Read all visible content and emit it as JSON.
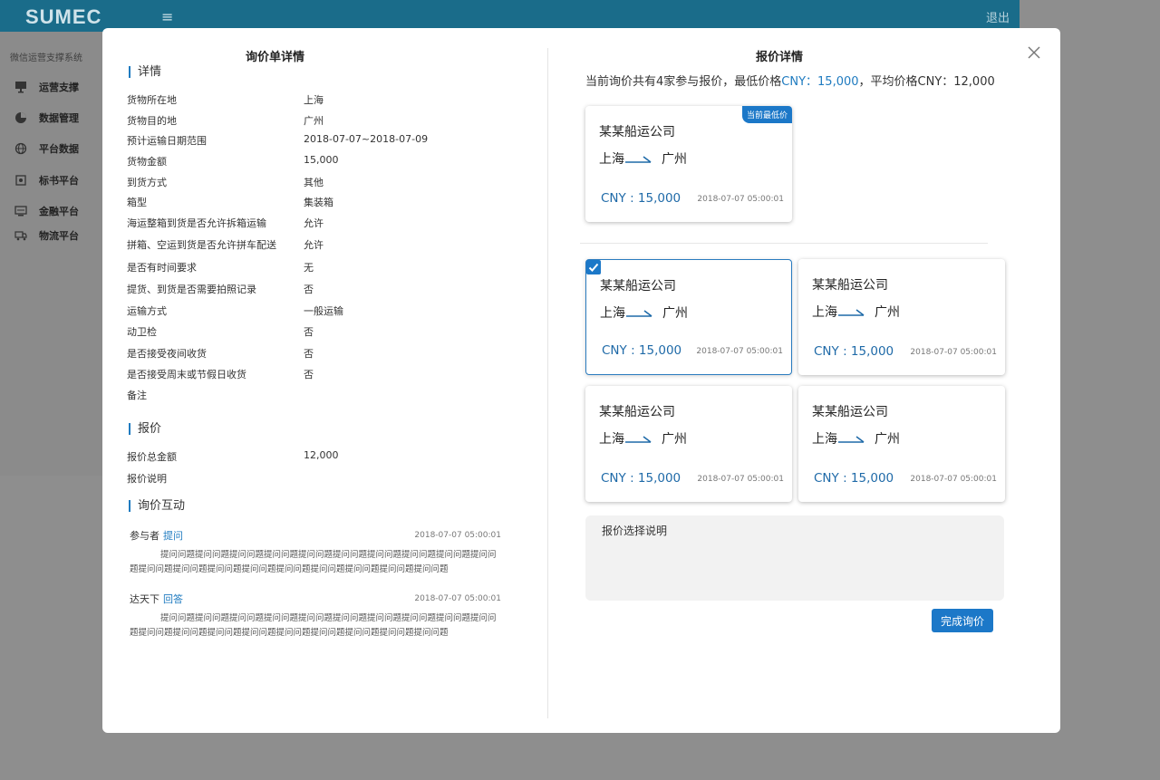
{
  "app": {
    "logo": "SUMEC",
    "menu_icon": "≡",
    "logout": "退出",
    "system_title": "微信运营支撑系统",
    "nav": [
      {
        "label": "运营支撑",
        "icon": "monitor-icon"
      },
      {
        "label": "数据管理",
        "icon": "pie-chart-icon"
      },
      {
        "label": "平台数据",
        "icon": "globe-icon"
      },
      {
        "label": "标书平台",
        "icon": "bid-icon"
      },
      {
        "label": "金融平台",
        "icon": "finance-icon"
      },
      {
        "label": "物流平台",
        "icon": "truck-icon"
      }
    ]
  },
  "left_panel": {
    "title": "询价单详情",
    "details_title": "详情",
    "details": [
      {
        "k": "货物所在地",
        "v": "上海"
      },
      {
        "k": "货物目的地",
        "v": "广州"
      },
      {
        "k": "预计运输日期范围",
        "v": "2018-07-07~2018-07-09"
      },
      {
        "k": "货物金额",
        "v": "15,000"
      },
      {
        "k": "到货方式",
        "v": "其他"
      },
      {
        "k": "箱型",
        "v": "集装箱"
      },
      {
        "k": "海运整箱到货是否允许拆箱运输",
        "v": "允许"
      },
      {
        "k": "拼箱、空运到货是否允许拼车配送",
        "v": "允许"
      },
      {
        "k": "是否有时间要求",
        "v": "无"
      },
      {
        "k": "提货、到货是否需要拍照记录",
        "v": "否"
      },
      {
        "k": "运输方式",
        "v": "一般运输"
      },
      {
        "k": "动卫检",
        "v": "否"
      },
      {
        "k": "是否接受夜间收货",
        "v": "否"
      },
      {
        "k": "是否接受周末或节假日收货",
        "v": "否"
      },
      {
        "k": "备注",
        "v": ""
      }
    ],
    "quote_title": "报价",
    "quote": [
      {
        "k": "报价总金额",
        "v": "12,000"
      },
      {
        "k": "报价说明",
        "v": ""
      }
    ],
    "interaction_title": "询价互动",
    "messages": [
      {
        "who": "参与者",
        "action": "提问",
        "time": "2018-07-07  05:00:01",
        "body": "提问问题提问问题提问问题提问问题提问问题提问问题提问问题提问问题提问问题提问问题提问问题提问问题提问问题提问问题提问问题提问问题提问问题提问问题提问问题"
      },
      {
        "who": "达天下",
        "action": "回答",
        "time": "2018-07-07  05:00:01",
        "body": "提问问题提问问题提问问题提问问题提问问题提问问题提问问题提问问题提问问题提问问题提问问题提问问题提问问题提问问题提问问题提问问题提问问题提问问题提问问题"
      }
    ]
  },
  "right_panel": {
    "title": "报价详情",
    "summary_prefix": "当前询价共有4家参与报价，最低价格",
    "summary_lowest": "CNY：15,000",
    "summary_suffix": "，平均价格CNY：12,000",
    "lowest_badge": "当前最低价",
    "cards": [
      {
        "company": "某某船运公司",
        "from": "上海",
        "to": "广州",
        "price": "CNY : 15,000",
        "time": "2018-07-07  05:00:01"
      },
      {
        "company": "某某船运公司",
        "from": "上海",
        "to": "广州",
        "price": "CNY : 15,000",
        "time": "2018-07-07  05:00:01"
      },
      {
        "company": "某某船运公司",
        "from": "上海",
        "to": "广州",
        "price": "CNY : 15,000",
        "time": "2018-07-07  05:00:01"
      },
      {
        "company": "某某船运公司",
        "from": "上海",
        "to": "广州",
        "price": "CNY : 15,000",
        "time": "2018-07-07  05:00:01"
      },
      {
        "company": "某某船运公司",
        "from": "上海",
        "to": "广州",
        "price": "CNY : 15,000",
        "time": "2018-07-07  05:00:01"
      }
    ],
    "note_placeholder": "报价选择说明",
    "finish_button": "完成询价"
  },
  "colors": {
    "accent": "#1c78c8",
    "header": "#1a6c8a"
  }
}
